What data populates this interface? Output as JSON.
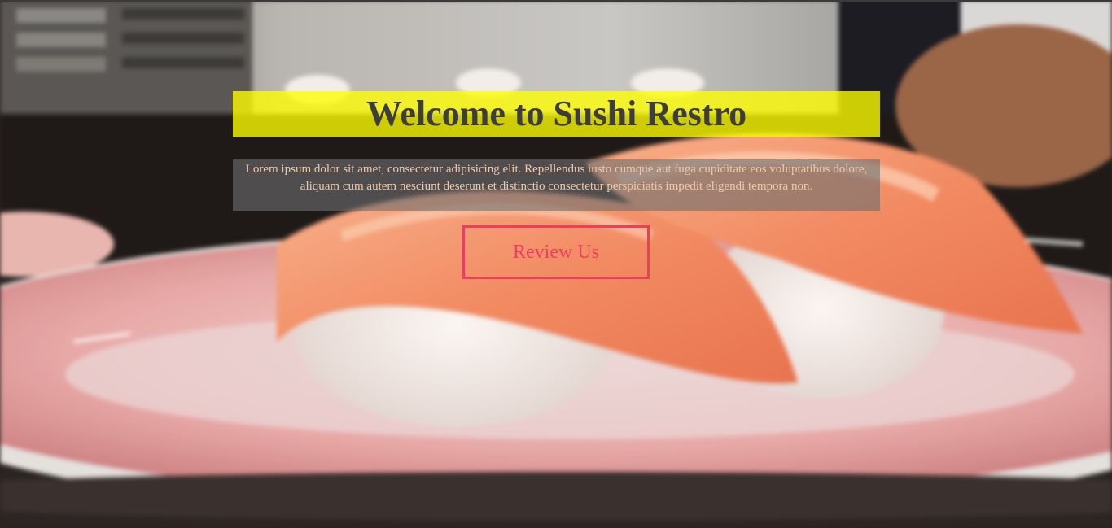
{
  "hero": {
    "title": "Welcome to Sushi Restro",
    "description": "Lorem ipsum dolor sit amet, consectetur adipisicing elit. Repellendus iusto cumque aut fuga cupiditate eos voluptatibus dolore, aliquam cum autem nesciunt deserunt et distinctio consectetur perspiciatis impedit eligendi tempora non.",
    "button_label": "Review Us",
    "background": "sushi-video-background"
  },
  "colors": {
    "title_background": "#ffff00",
    "title_text": "#3d3d3d",
    "description_text": "#f0c9a8",
    "button_accent": "#ee3d63"
  }
}
